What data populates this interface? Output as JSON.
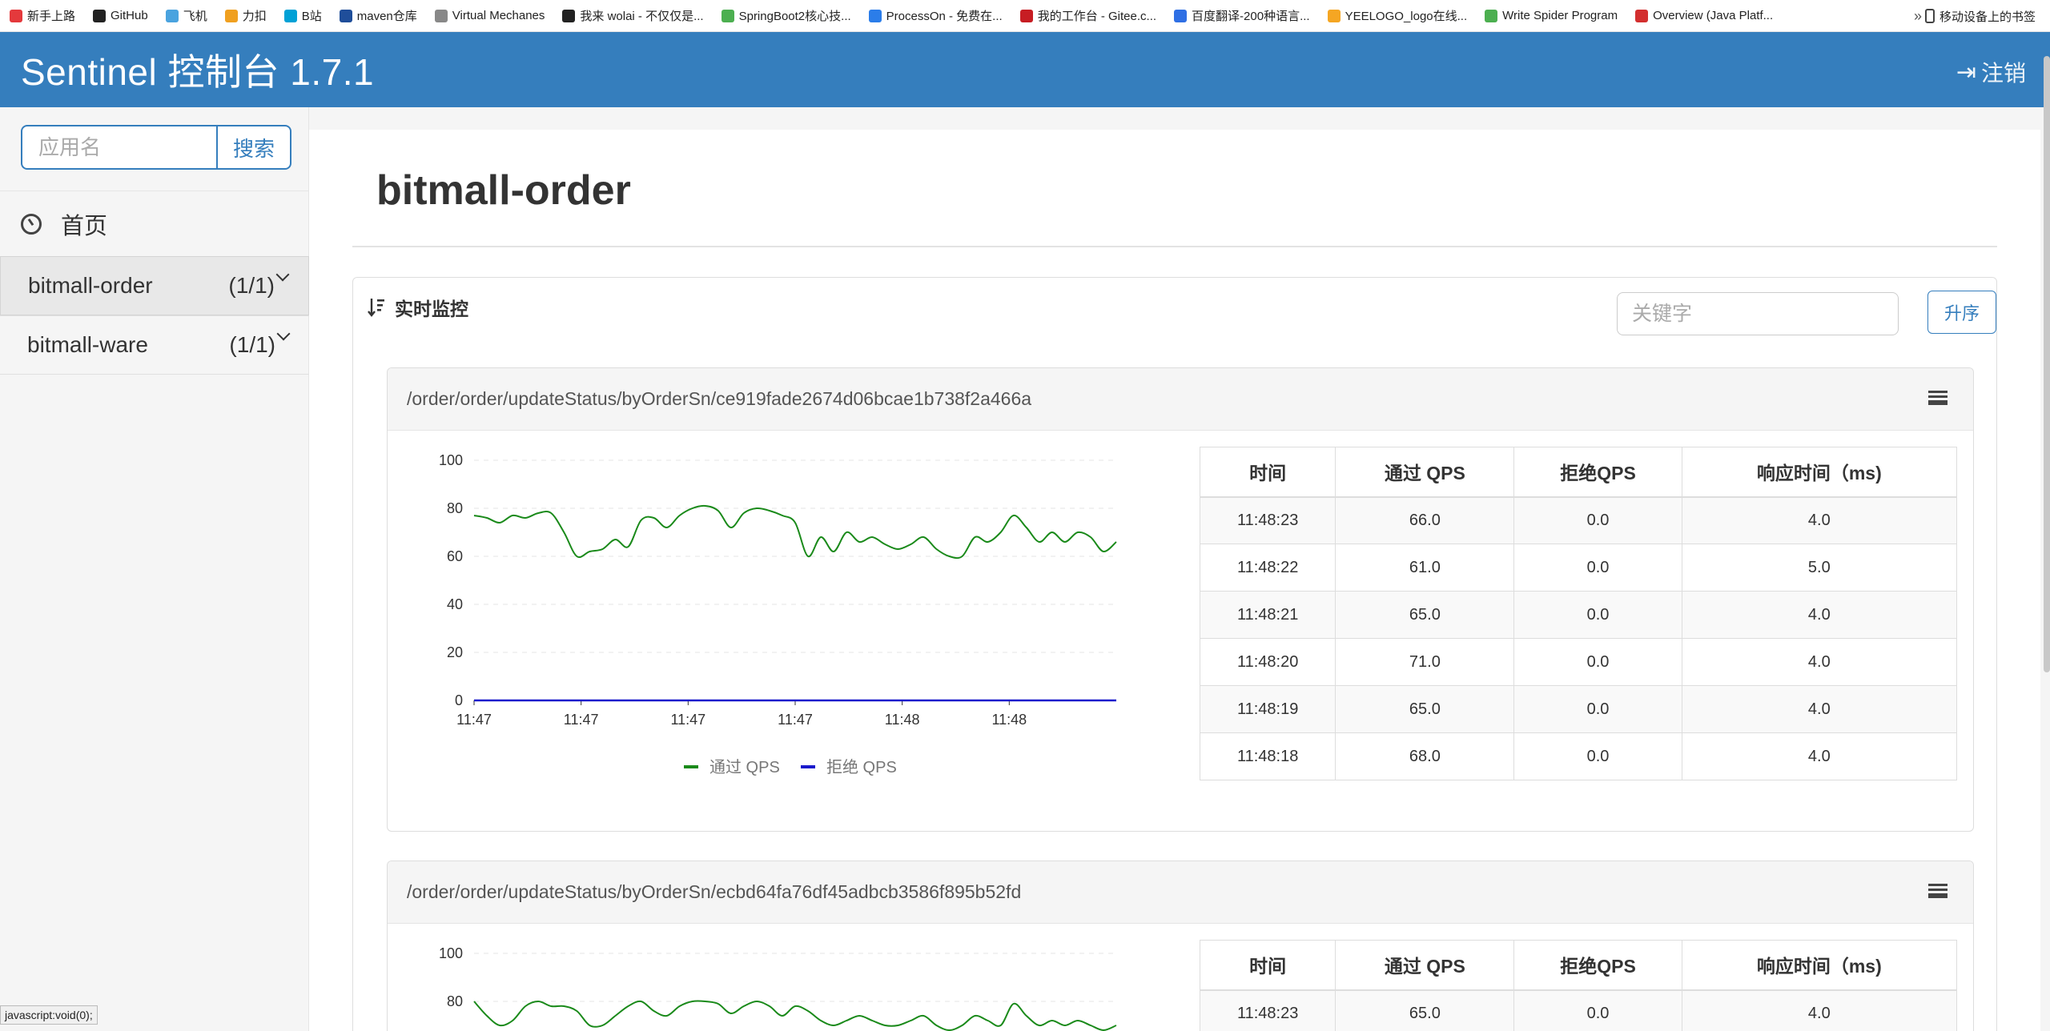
{
  "bookmarks": [
    {
      "label": "新手上路",
      "color": "#e4393c"
    },
    {
      "label": "GitHub",
      "color": "#222222"
    },
    {
      "label": "飞机",
      "color": "#4aa3df"
    },
    {
      "label": "力扣",
      "color": "#f0a020"
    },
    {
      "label": "B站",
      "color": "#00a1d6"
    },
    {
      "label": "maven仓库",
      "color": "#1f4e9a"
    },
    {
      "label": "Virtual Mechanes",
      "color": "#888888"
    },
    {
      "label": "我来 wolai - 不仅仅是...",
      "color": "#222222"
    },
    {
      "label": "SpringBoot2核心技...",
      "color": "#4caf50"
    },
    {
      "label": "ProcessOn - 免费在...",
      "color": "#2b7de9"
    },
    {
      "label": "我的工作台 - Gitee.c...",
      "color": "#c71d23"
    },
    {
      "label": "百度翻译-200种语言...",
      "color": "#2f6fe4"
    },
    {
      "label": "YEELOGO_logo在线...",
      "color": "#f5a623"
    },
    {
      "label": "Write Spider Program",
      "color": "#4caf50"
    },
    {
      "label": "Overview (Java Platf...",
      "color": "#d32f2f"
    }
  ],
  "bookmarks_overflow": "»",
  "mobile_bookmarks": "移动设备上的书签",
  "header": {
    "title": "Sentinel 控制台 1.7.1",
    "logout": "注销"
  },
  "sidebar": {
    "search_placeholder": "应用名",
    "search_button": "搜索",
    "home": "首页",
    "apps": [
      {
        "name": "bitmall-order",
        "count": "(1/1)"
      },
      {
        "name": "bitmall-ware",
        "count": "(1/1)"
      }
    ]
  },
  "main": {
    "app_title": "bitmall-order",
    "section_title": "实时监控",
    "keyword_placeholder": "关键字",
    "sort_button": "升序"
  },
  "colors": {
    "header": "#357ebd",
    "pass": "#1a8a1a",
    "block": "#1a1acc"
  },
  "table_headers": [
    "时间",
    "通过 QPS",
    "拒绝QPS",
    "响应时间（ms)"
  ],
  "resources": [
    {
      "path": "/order/order/updateStatus/byOrderSn/ce919fade2674d06bcae1b738f2a466a",
      "rows": [
        [
          "11:48:23",
          "66.0",
          "0.0",
          "4.0"
        ],
        [
          "11:48:22",
          "61.0",
          "0.0",
          "5.0"
        ],
        [
          "11:48:21",
          "65.0",
          "0.0",
          "4.0"
        ],
        [
          "11:48:20",
          "71.0",
          "0.0",
          "4.0"
        ],
        [
          "11:48:19",
          "65.0",
          "0.0",
          "4.0"
        ],
        [
          "11:48:18",
          "68.0",
          "0.0",
          "4.0"
        ]
      ]
    },
    {
      "path": "/order/order/updateStatus/byOrderSn/ecbd64fa76df45adbcb3586f895b52fd",
      "rows": [
        [
          "11:48:23",
          "65.0",
          "0.0",
          "4.0"
        ]
      ]
    }
  ],
  "chart_data": [
    {
      "type": "line",
      "categories": [
        "11:47",
        "11:47",
        "11:47",
        "11:47",
        "11:48",
        "11:48"
      ],
      "ylim": [
        0,
        100
      ],
      "yticks": [
        0,
        20,
        40,
        60,
        80,
        100
      ],
      "series": [
        {
          "name": "通过 QPS",
          "values": [
            77,
            76,
            74,
            77,
            76,
            78,
            78,
            70,
            60,
            62,
            63,
            67,
            64,
            75,
            76,
            72,
            77,
            80,
            81,
            79,
            72,
            78,
            80,
            79,
            77,
            74,
            60,
            68,
            62,
            70,
            66,
            68,
            65,
            63,
            65,
            68,
            63,
            60,
            60,
            68,
            66,
            70,
            77,
            72,
            66,
            70,
            66,
            70,
            68,
            62,
            66
          ]
        },
        {
          "name": "拒绝 QPS",
          "values": [
            0,
            0,
            0,
            0,
            0,
            0,
            0,
            0,
            0,
            0,
            0,
            0,
            0,
            0,
            0,
            0,
            0,
            0,
            0,
            0,
            0,
            0,
            0,
            0,
            0,
            0,
            0,
            0,
            0,
            0,
            0,
            0,
            0,
            0,
            0,
            0,
            0,
            0,
            0,
            0,
            0,
            0,
            0,
            0,
            0,
            0,
            0,
            0,
            0,
            0,
            0
          ]
        }
      ],
      "legend": "bottom-center"
    },
    {
      "type": "line",
      "categories": [],
      "ylim": [
        0,
        100
      ],
      "yticks": [
        80,
        100
      ],
      "series": [
        {
          "name": "通过 QPS",
          "values": [
            80,
            74,
            70,
            72,
            78,
            80,
            78,
            78,
            76,
            70,
            70,
            74,
            78,
            80,
            76,
            74,
            78,
            80,
            80,
            79,
            75,
            78,
            80,
            78,
            74,
            78,
            76,
            72,
            70,
            72,
            74,
            72,
            70,
            70,
            72,
            74,
            70,
            68,
            70,
            74,
            72,
            70,
            79,
            74,
            70,
            72,
            70,
            72,
            70,
            68,
            70
          ]
        }
      ]
    }
  ]
}
